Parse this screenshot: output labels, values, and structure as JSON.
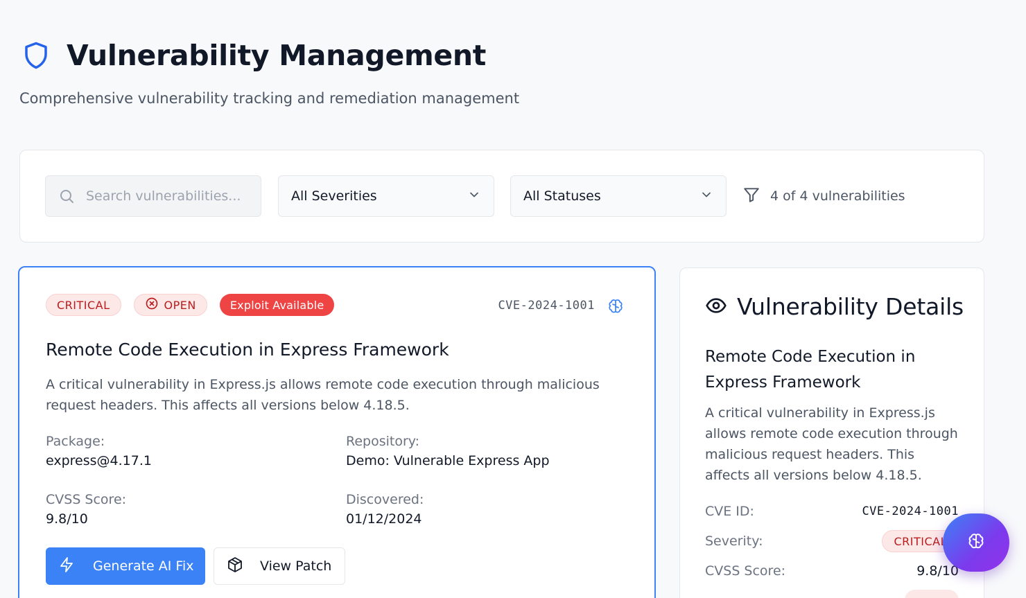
{
  "header": {
    "title": "Vulnerability Management",
    "subtitle": "Comprehensive vulnerability tracking and remediation management"
  },
  "filters": {
    "search_placeholder": "Search vulnerabilities...",
    "severity_selected": "All Severities",
    "status_selected": "All Statuses",
    "count_text": "4 of 4 vulnerabilities"
  },
  "vulnerability": {
    "severity_badge": "CRITICAL",
    "status_badge": "OPEN",
    "exploit_badge": "Exploit Available",
    "cve_id": "CVE-2024-1001",
    "title": "Remote Code Execution in Express Framework",
    "description": "A critical vulnerability in Express.js allows remote code execution through malicious request headers. This affects all versions below 4.18.5.",
    "package_label": "Package:",
    "package_value": "express@4.17.1",
    "repository_label": "Repository:",
    "repository_value": "Demo: Vulnerable Express App",
    "cvss_label": "CVSS Score:",
    "cvss_value": "9.8/10",
    "discovered_label": "Discovered:",
    "discovered_value": "01/12/2024",
    "generate_fix_label": "Generate AI Fix",
    "view_patch_label": "View Patch"
  },
  "details": {
    "heading": "Vulnerability Details",
    "title": "Remote Code Execution in Express Framework",
    "description": "A critical vulnerability in Express.js allows remote code execution through malicious request headers. This affects all versions below 4.18.5.",
    "cve_label": "CVE ID:",
    "cve_value": "CVE-2024-1001",
    "severity_label": "Severity:",
    "severity_value": "CRITICAL",
    "cvss_label": "CVSS Score:",
    "cvss_value": "9.8/10"
  },
  "colors": {
    "accent": "#3b82f6",
    "critical": "#b91c1c",
    "exploit": "#ef4444",
    "fab_gradient_end": "#9333ea"
  },
  "icons": [
    "shield-icon",
    "search-icon",
    "chevron-down-icon",
    "filter-icon",
    "x-circle-icon",
    "brain-icon",
    "zap-icon",
    "package-icon",
    "eye-icon"
  ]
}
